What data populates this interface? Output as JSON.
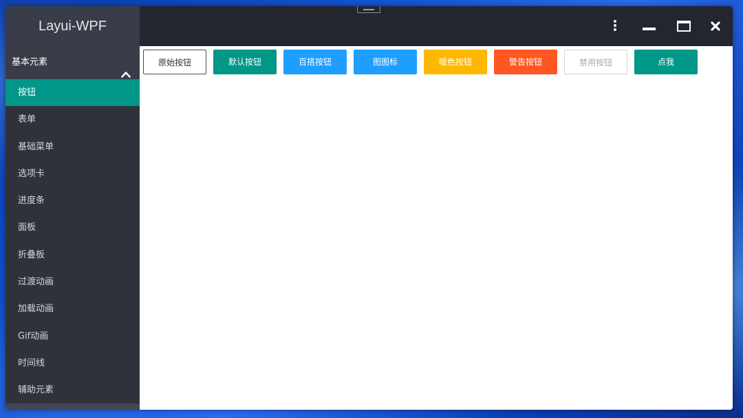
{
  "app": {
    "title": "Layui-WPF"
  },
  "sidebar": {
    "group": {
      "label": "基本元素"
    },
    "items": [
      {
        "label": "按钮"
      },
      {
        "label": "表单"
      },
      {
        "label": "基础菜单"
      },
      {
        "label": "选项卡"
      },
      {
        "label": "进度条"
      },
      {
        "label": "面板"
      },
      {
        "label": "折叠板"
      },
      {
        "label": "过渡动画"
      },
      {
        "label": "加载动画"
      },
      {
        "label": "Gif动画"
      },
      {
        "label": "时间线"
      },
      {
        "label": "辅助元素"
      }
    ]
  },
  "buttons": {
    "primary": "原始按钮",
    "default": "默认按钮",
    "normal": "百搭按钮",
    "icon": "图图标",
    "warm": "暖色按钮",
    "danger": "警告按钮",
    "disabled": "禁用按钮",
    "click": "点我"
  },
  "colors": {
    "accent": "#009688",
    "normal": "#1e9fff",
    "warm": "#ffb800",
    "danger": "#ff5722",
    "titlebar": "#23262e",
    "sidebar": "#2f323b"
  },
  "icons": {
    "menu": "more-vertical-icon",
    "minimize": "minimize-icon",
    "maximize": "maximize-icon",
    "close": "close-icon",
    "collapse": "chevron-up-icon"
  }
}
